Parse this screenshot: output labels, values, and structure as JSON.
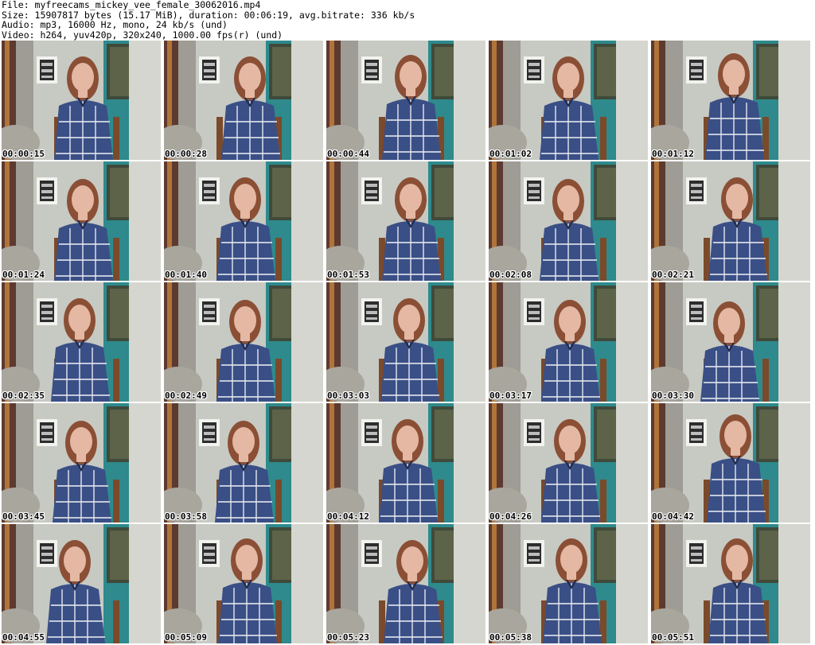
{
  "header": {
    "lines": [
      "File: myfreecams_mickey_vee_female_30062016.mp4",
      "Size: 15907817 bytes (15.17 MiB), duration: 00:06:19, avg.bitrate: 336 kb/s",
      "Audio: mp3, 16000 Hz, mono, 24 kb/s (und)",
      "Video: h264, yuv420p, 320x240, 1000.00 fps(r) (und)"
    ]
  },
  "thumbnails": [
    {
      "timestamp": "00:00:15"
    },
    {
      "timestamp": "00:00:28"
    },
    {
      "timestamp": "00:00:44"
    },
    {
      "timestamp": "00:01:02"
    },
    {
      "timestamp": "00:01:12"
    },
    {
      "timestamp": "00:01:24"
    },
    {
      "timestamp": "00:01:40"
    },
    {
      "timestamp": "00:01:53"
    },
    {
      "timestamp": "00:02:08"
    },
    {
      "timestamp": "00:02:21"
    },
    {
      "timestamp": "00:02:35"
    },
    {
      "timestamp": "00:02:49"
    },
    {
      "timestamp": "00:03:03"
    },
    {
      "timestamp": "00:03:17"
    },
    {
      "timestamp": "00:03:30"
    },
    {
      "timestamp": "00:03:45"
    },
    {
      "timestamp": "00:03:58"
    },
    {
      "timestamp": "00:04:12"
    },
    {
      "timestamp": "00:04:26"
    },
    {
      "timestamp": "00:04:42"
    },
    {
      "timestamp": "00:04:55"
    },
    {
      "timestamp": "00:05:09"
    },
    {
      "timestamp": "00:05:23"
    },
    {
      "timestamp": "00:05:38"
    },
    {
      "timestamp": "00:05:51"
    }
  ],
  "colors": {
    "wall": "#c7c9c3",
    "teal_wall": "#2e8a8c",
    "shirt": "#3a4f86",
    "hair": "#8b4f35",
    "skin": "#e4b8a3"
  }
}
